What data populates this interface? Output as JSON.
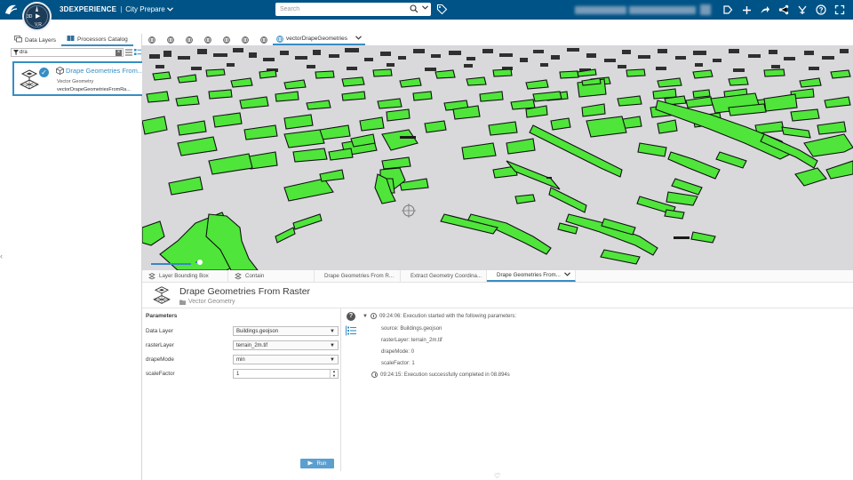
{
  "topbar": {
    "brand": "3DEXPERIENCE",
    "separator": "|",
    "app_name": "City Prepare",
    "search_placeholder": "Search",
    "compass_labels": {
      "n": "3D",
      "s": "V,R",
      "play": "▶"
    },
    "colors": {
      "bar": "#005386",
      "accent": "#368ec4"
    }
  },
  "left_panel": {
    "tabs": [
      {
        "label": "Data Layers",
        "icon": "layers-icon"
      },
      {
        "label": "Processors Catalog",
        "icon": "catalog-icon",
        "active": true
      }
    ],
    "filter_value": "dra",
    "processor_card": {
      "title": "Drape Geometries From...",
      "category": "Vector Geometry",
      "id": "vectorDrapeGeometriesFromRa..."
    }
  },
  "viewer_tabs": {
    "globe_tabs_count": 7,
    "active_tab": "vectorDrapeGeometries"
  },
  "bottom_tabs": [
    {
      "label": "Layer Bounding Box"
    },
    {
      "label": "Contain"
    },
    {
      "label": "Drape Geometries From R..."
    },
    {
      "label": "Extract Geometry Coordina..."
    },
    {
      "label": "Drape Geometries From...",
      "active": true
    }
  ],
  "processor_header": {
    "title": "Drape Geometries From Raster",
    "category": "Vector Geometry"
  },
  "parameters": {
    "title": "Parameters",
    "rows": [
      {
        "label": "Data Layer",
        "value": "Buildings.geojson",
        "kind": "select"
      },
      {
        "label": "rasterLayer",
        "value": "terrain_2m.tif",
        "kind": "select"
      },
      {
        "label": "drapeMode",
        "value": "min",
        "kind": "select"
      },
      {
        "label": "scaleFactor",
        "value": "1",
        "kind": "number"
      }
    ],
    "run_label": "Run"
  },
  "log": {
    "start": "09:24:06: Execution started with the following parameters:",
    "params": [
      "source: Buildings.geojson",
      "rasterLayer: terrain_2m.tif",
      "drapeMode: 0",
      "scaleFactor: 1"
    ],
    "end": "09:24:15: Execution successfully completed in 08.894s"
  }
}
